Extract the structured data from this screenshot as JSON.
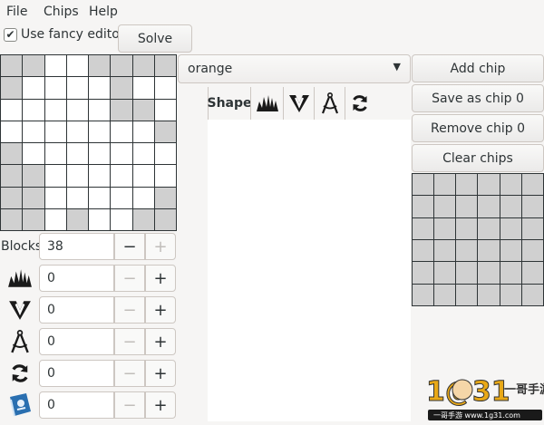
{
  "menubar": {
    "file": "File",
    "chips": "Chips",
    "help": "Help"
  },
  "toolbar": {
    "fancy_editor_label": "Use fancy editor",
    "fancy_editor_checked": "✔",
    "solve": "Solve"
  },
  "combo": {
    "selected": "orange"
  },
  "list_header": {
    "shape": "Shape"
  },
  "actions": {
    "add_chip": "Add chip",
    "save_chip": "Save as chip 0",
    "remove_chip": "Remove chip 0",
    "clear_chips": "Clear chips"
  },
  "counters": {
    "blocks": {
      "label": "Blocks",
      "value": "38"
    },
    "rows": [
      {
        "icon": "spikes-icon",
        "value": "0"
      },
      {
        "icon": "double-chevron-icon",
        "value": "0"
      },
      {
        "icon": "compass-icon",
        "value": "0"
      },
      {
        "icon": "refresh-icon",
        "value": "0"
      },
      {
        "icon": "book-icon",
        "value": "0"
      }
    ],
    "minus": "−",
    "plus": "+"
  },
  "watermark": {
    "text_main": "1@31",
    "text_cn": "一哥手游",
    "url": "一哥手游 www.1g31.com"
  }
}
